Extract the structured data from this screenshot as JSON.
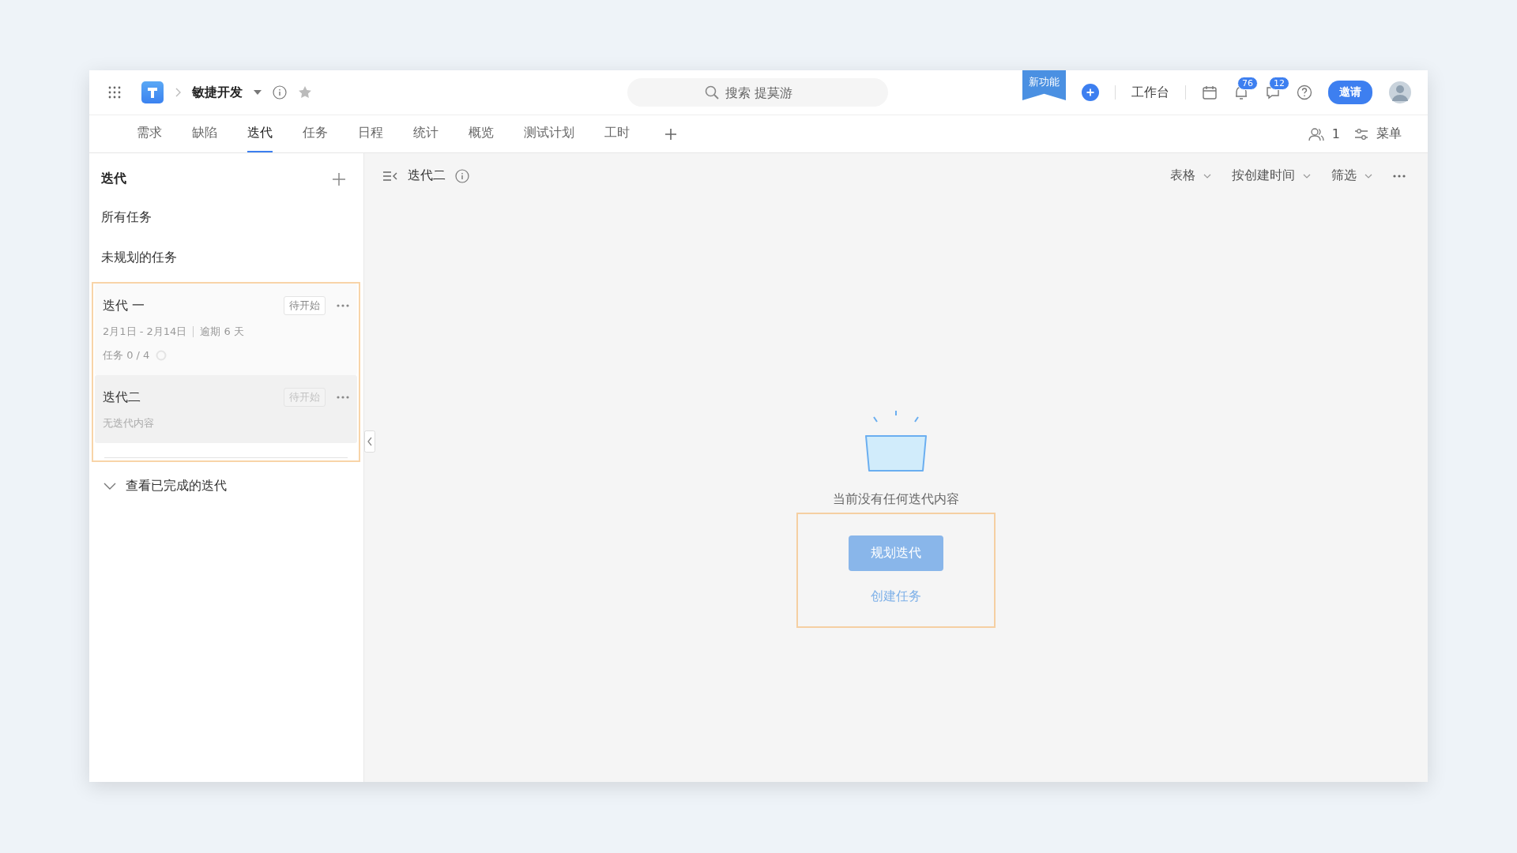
{
  "header": {
    "project": "敏捷开发",
    "search_placeholder": "搜索 提莫游",
    "new_feature": "新功能",
    "workbench": "工作台",
    "notification_count": "76",
    "message_count": "12",
    "invite": "邀请"
  },
  "tabs": [
    {
      "label": "需求",
      "selected": false
    },
    {
      "label": "缺陷",
      "selected": false
    },
    {
      "label": "迭代",
      "selected": true
    },
    {
      "label": "任务",
      "selected": false
    },
    {
      "label": "日程",
      "selected": false
    },
    {
      "label": "统计",
      "selected": false
    },
    {
      "label": "概览",
      "selected": false
    },
    {
      "label": "测试计划",
      "selected": false
    },
    {
      "label": "工时",
      "selected": false
    }
  ],
  "tab_tools": {
    "members": "1",
    "menu": "菜单"
  },
  "sidebar": {
    "title": "迭代",
    "items": [
      "所有任务",
      "未规划的任务"
    ],
    "iterations": [
      {
        "name": "迭代 一",
        "status": "待开始",
        "dates": "2月1日 - 2月14日",
        "overdue": "逾期 6 天",
        "tasks": "任务 0 / 4",
        "selected": false
      },
      {
        "name": "迭代二",
        "status": "待开始",
        "note": "无迭代内容",
        "selected": true
      }
    ],
    "completed": "查看已完成的迭代"
  },
  "main": {
    "title": "迭代二",
    "controls": [
      "表格",
      "按创建时间",
      "筛选"
    ],
    "empty": {
      "message": "当前没有任何迭代内容",
      "primary": "规划迭代",
      "link": "创建任务"
    }
  }
}
